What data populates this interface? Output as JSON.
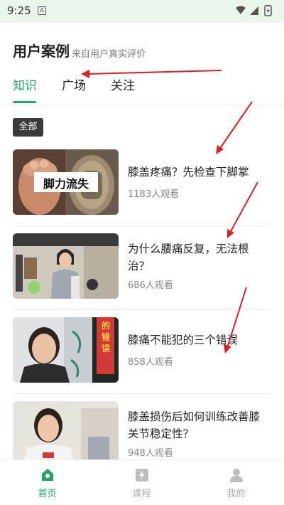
{
  "status_bar": {
    "time": "9:25",
    "notif_badge": "A"
  },
  "header": {
    "title": "用户案例",
    "subtitle": "来自用户真实评价"
  },
  "tabs": [
    {
      "label": "知识",
      "active": true
    },
    {
      "label": "广场",
      "active": false
    },
    {
      "label": "关注",
      "active": false
    }
  ],
  "filter": {
    "chip_label": "全部"
  },
  "items": [
    {
      "title": "膝盖疼痛？先检查下脚掌",
      "views": "1183人观看",
      "thumb_caption": "脚力流失"
    },
    {
      "title": "为什么腰痛反复，无法根治？",
      "views": "686人观看"
    },
    {
      "title": "膝痛不能犯的三个错误",
      "views": "858人观看",
      "thumb_caption": "的错误"
    },
    {
      "title": "膝盖损伤后如何训练改善膝关节稳定性？",
      "views": "948人观看"
    }
  ],
  "bottom_nav": [
    {
      "label": "首页",
      "icon": "home-icon",
      "active": true
    },
    {
      "label": "课程",
      "icon": "lightning-icon",
      "active": false
    },
    {
      "label": "我的",
      "icon": "user-icon",
      "active": false
    }
  ],
  "colors": {
    "accent": "#22a565",
    "arrow": "#e02020"
  }
}
